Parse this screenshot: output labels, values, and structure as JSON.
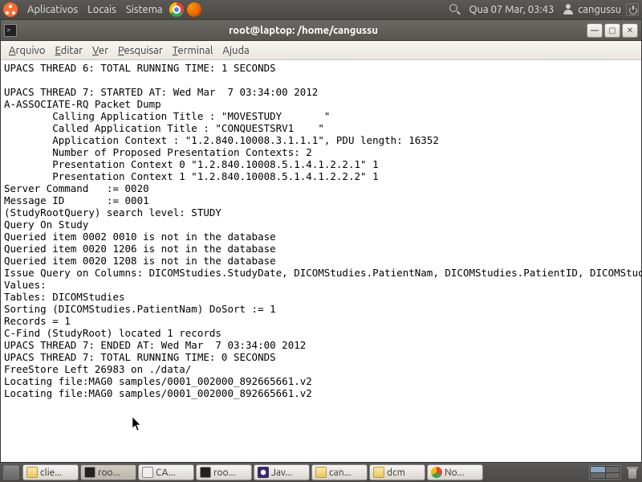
{
  "top_panel": {
    "menus": [
      "Aplicativos",
      "Locais",
      "Sistema"
    ],
    "clock": "Qua 07 Mar, 03:43",
    "username": "cangussu"
  },
  "window": {
    "title": "root@laptop: /home/cangussu",
    "min_label": "—",
    "max_label": "▢",
    "close_label": "✕"
  },
  "menubar": {
    "arquivo": "Arquivo",
    "editar": "Editar",
    "ver": "Ver",
    "pesquisar": "Pesquisar",
    "terminal": "Terminal",
    "ajuda": "Ajuda"
  },
  "terminal_lines": [
    "UPACS THREAD 6: TOTAL RUNNING TIME: 1 SECONDS",
    "",
    "UPACS THREAD 7: STARTED AT: Wed Mar  7 03:34:00 2012",
    "A-ASSOCIATE-RQ Packet Dump",
    "        Calling Application Title : \"MOVESTUDY       \"",
    "        Called Application Title : \"CONQUESTSRV1    \"",
    "        Application Context : \"1.2.840.10008.3.1.1.1\", PDU length: 16352",
    "        Number of Proposed Presentation Contexts: 2",
    "        Presentation Context 0 \"1.2.840.10008.5.1.4.1.2.2.1\" 1",
    "        Presentation Context 1 \"1.2.840.10008.5.1.4.1.2.2.2\" 1",
    "Server Command   := 0020",
    "Message ID       := 0001",
    "(StudyRootQuery) search level: STUDY",
    "Query On Study",
    "Queried item 0002 0010 is not in the database",
    "Queried item 0020 1206 is not in the database",
    "Queried item 0020 1208 is not in the database",
    "Issue Query on Columns: DICOMStudies.StudyDate, DICOMStudies.PatientNam, DICOMStudies.PatientID, DICOMStudies.StudyInsta",
    "Values:",
    "Tables: DICOMStudies",
    "Sorting (DICOMStudies.PatientNam) DoSort := 1",
    "Records = 1",
    "C-Find (StudyRoot) located 1 records",
    "UPACS THREAD 7: ENDED AT: Wed Mar  7 03:34:00 2012",
    "UPACS THREAD 7: TOTAL RUNNING TIME: 0 SECONDS",
    "FreeStore Left 26983 on ./data/",
    "Locating file:MAG0 samples/0001_002000_892665661.v2",
    "Locating file:MAG0 samples/0001_002000_892665661.v2"
  ],
  "taskbar": [
    {
      "label": "clie...",
      "icon": "folder"
    },
    {
      "label": "roo...",
      "icon": "term",
      "active": true
    },
    {
      "label": "CA...",
      "icon": "gedit"
    },
    {
      "label": "roo...",
      "icon": "term"
    },
    {
      "label": "Jav...",
      "icon": "eclipse"
    },
    {
      "label": "can...",
      "icon": "folder"
    },
    {
      "label": "dcm",
      "icon": "folder"
    },
    {
      "label": "No...",
      "icon": "chrome"
    }
  ]
}
